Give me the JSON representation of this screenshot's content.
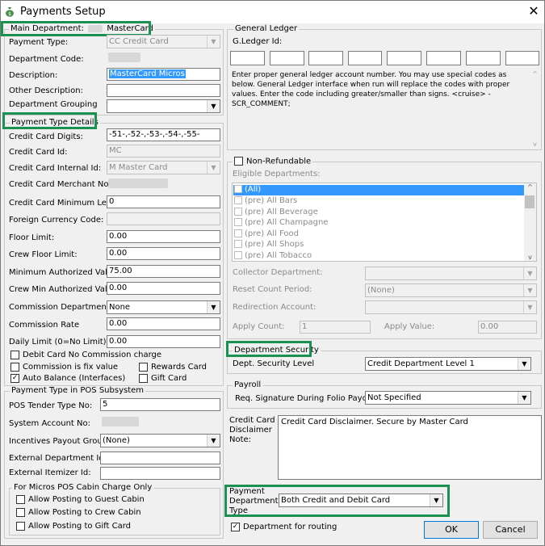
{
  "window": {
    "title": "Payments Setup",
    "close": "✕"
  },
  "main": {
    "legend_prefix": "Main Department:",
    "legend_value": "MasterCard",
    "payment_type_label": "Payment Type:",
    "payment_type_value": "CC Credit Card",
    "department_code_label": "Department Code:",
    "description_label": "Description:",
    "description_value": "MasterCard Micros",
    "other_description_label": "Other Description:",
    "department_grouping_label": "Department Grouping"
  },
  "ptd": {
    "legend": "Payment Type Details",
    "cc_digits_label": "Credit Card Digits:",
    "cc_digits_value": "-51-,-52-,-53-,-54-,-55-",
    "cc_id_label": "Credit Card Id:",
    "cc_id_value": "MC",
    "cc_internal_id_label": "Credit Card Internal Id:",
    "cc_internal_id_value": "M Master Card",
    "cc_merchant_label": "Credit Card Merchant No:",
    "cc_min_len_label": "Credit Card Minimum Len:",
    "cc_min_len_value": "0",
    "foreign_currency_label": "Foreign Currency Code:",
    "floor_limit_label": "Floor Limit:",
    "floor_limit_value": "0.00",
    "crew_floor_limit_label": "Crew Floor Limit:",
    "crew_floor_limit_value": "0.00",
    "min_auth_label": "Minimum Authorized Value:",
    "min_auth_value": "75.00",
    "crew_min_auth_label": "Crew Min Authorized Value:",
    "crew_min_auth_value": "0.00",
    "commission_dept_label": "Commission Department",
    "commission_dept_value": "None",
    "commission_rate_label": "Commission Rate",
    "commission_rate_value": "0.00",
    "daily_limit_label": "Daily Limit (0=No Limit):",
    "daily_limit_value": "0.00",
    "debit_no_commission_label": "Debit Card No Commission charge",
    "commission_fix_label": "Commission is fix value",
    "rewards_card_label": "Rewards Card",
    "auto_balance_label": "Auto Balance (Interfaces)",
    "gift_card_label": "Gift Card",
    "check_mark": "✓"
  },
  "pos": {
    "legend": "Payment Type in POS Subsystem",
    "tender_label": "POS Tender Type No:",
    "tender_value": "5",
    "system_account_label": "System Account No:",
    "incentives_label": "Incentives Payout Group:",
    "incentives_value": "(None)",
    "ext_dept_label": "External Department Id:",
    "ext_itemizer_label": "External Itemizer Id:",
    "micros_legend": "For Micros POS Cabin Charge Only",
    "allow_guest_label": "Allow Posting to Guest Cabin",
    "allow_crew_label": "Allow Posting to Crew Cabin",
    "allow_gift_label": "Allow Posting to Gift Card"
  },
  "gl": {
    "legend": "General Ledger",
    "id_label": "G.Ledger Id:",
    "help_text": "Enter proper general ledger account number. You may use special codes as below. General Ledger interface when run will replace the codes with proper values. Enter the code including greater/smaller than signs.  <cruise> - SCR_COMMENT;"
  },
  "nonref": {
    "legend": "Non-Refundable",
    "eligible_label": "Eligible Departments:",
    "items": [
      "(All)",
      "(pre) All Bars",
      "(pre) All Beverage",
      "(pre) All Champagne",
      "(pre) All Food",
      "(pre) All Shops",
      "(pre) All Tobacco"
    ],
    "collector_label": "Collector Department:",
    "reset_count_label": "Reset Count Period:",
    "reset_count_value": "(None)",
    "redirection_label": "Redirection Account:",
    "apply_count_label": "Apply Count:",
    "apply_count_value": "1",
    "apply_value_label": "Apply Value:",
    "apply_value_value": "0.00"
  },
  "security": {
    "legend": "Department Security",
    "level_label": "Dept. Security Level",
    "level_value": "Credit Department Level 1"
  },
  "payroll": {
    "legend": "Payroll",
    "req_sig_label": "Req. Signature During Folio Payout",
    "req_sig_value": "Not Specified"
  },
  "disclaimer": {
    "label_1": "Credit Card",
    "label_2": "Disclaimer",
    "label_3": "Note:",
    "value": "Credit Card Disclaimer. Secure by Master Card"
  },
  "pdt": {
    "label_1": "Payment",
    "label_2": "Department",
    "label_3": "Type",
    "value": "Both Credit and Debit Card"
  },
  "footer": {
    "routing_label": "Department for routing",
    "ok_label": "OK",
    "cancel_label": "Cancel"
  },
  "colors": {
    "highlight": "#1a9150",
    "selection": "#3399ff"
  },
  "icons": {
    "app": "money-bag-icon",
    "close": "close-icon",
    "dropdown": "chevron-down-icon"
  }
}
